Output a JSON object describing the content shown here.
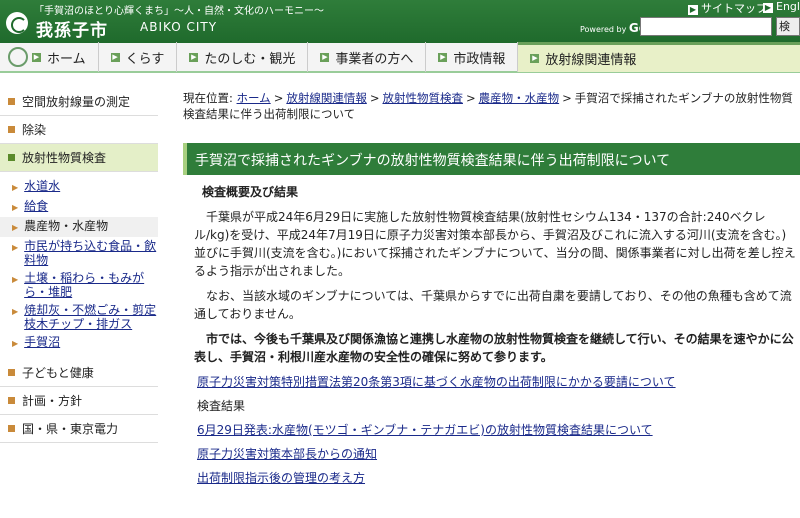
{
  "header": {
    "tagline": "「手賀沼のほとり心輝くまち」〜人・自然・文化のハーモニー〜",
    "city_name": "我孫子市",
    "city_name_en": "ABIKO CITY",
    "sitemap": "サイトマップ",
    "english": "English",
    "powered_by": "Powered by",
    "google": "Google",
    "search_placeholder": "",
    "search_button": "検索"
  },
  "nav": [
    {
      "label": "ホーム"
    },
    {
      "label": "くらす"
    },
    {
      "label": "たのしむ・観光"
    },
    {
      "label": "事業者の方へ"
    },
    {
      "label": "市政情報"
    },
    {
      "label": "放射線関連情報"
    }
  ],
  "sidebar": {
    "top_items": [
      {
        "label": "空間放射線量の測定"
      },
      {
        "label": "除染"
      },
      {
        "label": "放射性物質検査"
      }
    ],
    "sub_items": [
      {
        "label": "水道水"
      },
      {
        "label": "給食"
      },
      {
        "label": "農産物・水産物"
      },
      {
        "label": "市民が持ち込む食品・飲料物"
      },
      {
        "label": "土壌・稲わら・もみがら・堆肥"
      },
      {
        "label": "焼却灰・不燃ごみ・剪定枝木チップ・排ガス"
      },
      {
        "label": "手賀沼"
      }
    ],
    "bottom_items": [
      {
        "label": "子どもと健康"
      },
      {
        "label": "計画・方針"
      },
      {
        "label": "国・県・東京電力"
      }
    ]
  },
  "breadcrumb": {
    "prefix": "現在位置:",
    "links": [
      "ホーム",
      "放射線関連情報",
      "放射性物質検査",
      "農産物・水産物"
    ],
    "current": "手賀沼で採捕されたギンブナの放射性物質検査結果に伴う出荷制限について",
    "separator": ">"
  },
  "page": {
    "title": "手賀沼で採捕されたギンブナの放射性物質検査結果に伴う出荷制限について",
    "section_heading": "検査概要及び結果",
    "paragraph1": "千葉県が平成24年6月29日に実施した放射性物質検査結果(放射性セシウム134・137の合計:240ベクレル/kg)を受け、平成24年7月19日に原子力災害対策本部長から、手賀沼及びこれに流入する河川(支流を含む。)並びに手賀川(支流を含む。)において採捕されたギンブナについて、当分の間、関係事業者に対し出荷を差し控えるよう指示が出されました。",
    "paragraph2": "なお、当該水域のギンブナについては、千葉県からすでに出荷自粛を要請しており、その他の魚種も含めて流通しておりません。",
    "paragraph3": "市では、今後も千葉県及び関係漁協と連携し水産物の放射性物質検査を継続して行い、その結果を速やかに公表し、手賀沼・利根川産水産物の安全性の確保に努めて参ります。",
    "link1": "原子力災害対策特別措置法第20条第3項に基づく水産物の出荷制限にかかる要請について",
    "label_results": "検査結果",
    "link2": "6月29日発表:水産物(モツゴ・ギンブナ・テナガエビ)の放射性物質検査結果について",
    "link3": "原子力災害対策本部長からの通知",
    "link4": "出荷制限指示後の管理の考え方"
  }
}
